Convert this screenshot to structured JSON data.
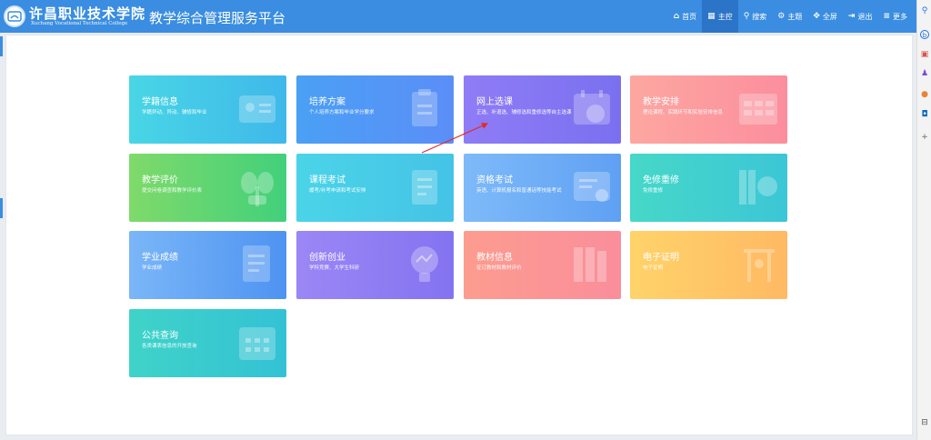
{
  "header": {
    "school_name_cn": "许昌职业技术学院",
    "school_name_en": "Xuchang  Vocational  Technical  College",
    "platform_title": "教学综合管理服务平台",
    "nav": [
      {
        "icon": "home-icon",
        "glyph": "⌂",
        "label": "首页"
      },
      {
        "icon": "grid-icon",
        "glyph": "▦",
        "label": "主控",
        "active": true
      },
      {
        "icon": "search-icon",
        "glyph": "⚲",
        "label": "搜索"
      },
      {
        "icon": "theme-icon",
        "glyph": "⚙",
        "label": "主题"
      },
      {
        "icon": "fullscreen-icon",
        "glyph": "✥",
        "label": "全屏"
      },
      {
        "icon": "logout-icon",
        "glyph": "⇥",
        "label": "退出"
      },
      {
        "icon": "menu-icon",
        "glyph": "≡",
        "label": "更多"
      }
    ]
  },
  "cards": [
    {
      "title": "学籍信息",
      "desc": "学籍异动、异动、辅修和毕业",
      "icon": "id-card-icon",
      "colors": [
        "#48d6e6",
        "#3fb8ea"
      ]
    },
    {
      "title": "培养方案",
      "desc": "个人培养方案和毕业学分要求",
      "icon": "document-icon",
      "colors": [
        "#4aa0f5",
        "#5b8ef7"
      ]
    },
    {
      "title": "网上选课",
      "desc": "正选、补退选、辅修选和重修选等自主选课",
      "icon": "calendar-hand-icon",
      "colors": [
        "#8f7cf6",
        "#7a70ef"
      ]
    },
    {
      "title": "教学安排",
      "desc": "理论课程、实践环节和实验安排信息",
      "icon": "timetable-icon",
      "colors": [
        "#fda7a0",
        "#fb8e9e"
      ]
    },
    {
      "title": "教学评价",
      "desc": "提交问卷调查和教学评价表",
      "icon": "plant-icon",
      "colors": [
        "#7fda6a",
        "#42d07b"
      ]
    },
    {
      "title": "课程考试",
      "desc": "缓考/补考申请和考试安排",
      "icon": "scroll-icon",
      "colors": [
        "#4bd4e8",
        "#44c3e6"
      ]
    },
    {
      "title": "资格考试",
      "desc": "英语、计算机报名和普通话等技能考试",
      "icon": "certificate-icon",
      "colors": [
        "#7ebaf9",
        "#5fa0f3"
      ]
    },
    {
      "title": "免修重修",
      "desc": "免修重修",
      "icon": "books-icon",
      "colors": [
        "#46d8c8",
        "#3cc6d6"
      ]
    },
    {
      "title": "学业成绩",
      "desc": "学业成绩",
      "icon": "report-icon",
      "colors": [
        "#7ab6f7",
        "#4e93f2"
      ]
    },
    {
      "title": "创新创业",
      "desc": "学科竞赛、大学生科研",
      "icon": "bulb-icon",
      "colors": [
        "#9b87f5",
        "#8473f1"
      ]
    },
    {
      "title": "教材信息",
      "desc": "征订教材和教材评价",
      "icon": "textbook-icon",
      "colors": [
        "#fc9c8f",
        "#fa8e9b"
      ]
    },
    {
      "title": "电子证明",
      "desc": "电子证明",
      "icon": "easel-icon",
      "colors": [
        "#ffd36a",
        "#ffb963"
      ]
    },
    {
      "title": "公共查询",
      "desc": "各类课表信息的开放查询",
      "icon": "calendar-icon",
      "colors": [
        "#3fd3c8",
        "#33c2d5"
      ]
    }
  ]
}
